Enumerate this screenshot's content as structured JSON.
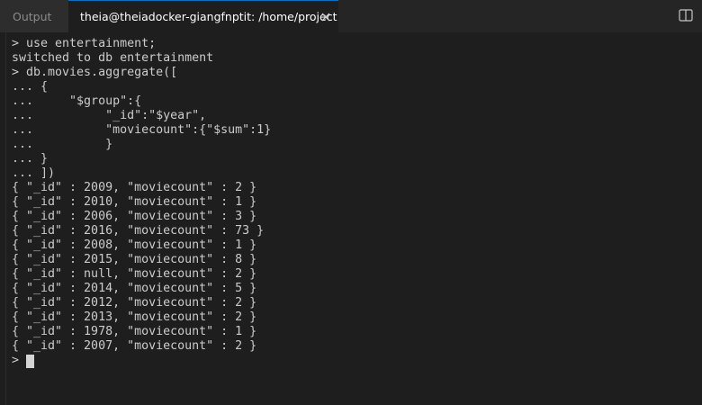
{
  "tabs": {
    "output_label": "Output",
    "terminal_label": "theia@theiadocker-giangfnptit: /home/project"
  },
  "icons": {
    "close": "close-icon",
    "split": "split-editor-icon"
  },
  "colors": {
    "background": "#1e1e1e",
    "tabbar": "#252526",
    "active_tab_border": "#0e70c0",
    "text": "#cccccc"
  },
  "terminal": {
    "lines": [
      "> use entertainment;",
      "switched to db entertainment",
      "> db.movies.aggregate([",
      "... {",
      "...     \"$group\":{",
      "...          \"_id\":\"$year\",",
      "...          \"moviecount\":{\"$sum\":1}",
      "...          }",
      "... }",
      "... ])",
      "{ \"_id\" : 2009, \"moviecount\" : 2 }",
      "{ \"_id\" : 2010, \"moviecount\" : 1 }",
      "{ \"_id\" : 2006, \"moviecount\" : 3 }",
      "{ \"_id\" : 2016, \"moviecount\" : 73 }",
      "{ \"_id\" : 2008, \"moviecount\" : 1 }",
      "{ \"_id\" : 2015, \"moviecount\" : 8 }",
      "{ \"_id\" : null, \"moviecount\" : 2 }",
      "{ \"_id\" : 2014, \"moviecount\" : 5 }",
      "{ \"_id\" : 2012, \"moviecount\" : 2 }",
      "{ \"_id\" : 2013, \"moviecount\" : 2 }",
      "{ \"_id\" : 1978, \"moviecount\" : 1 }",
      "{ \"_id\" : 2007, \"moviecount\" : 2 }"
    ],
    "prompt": ">"
  }
}
